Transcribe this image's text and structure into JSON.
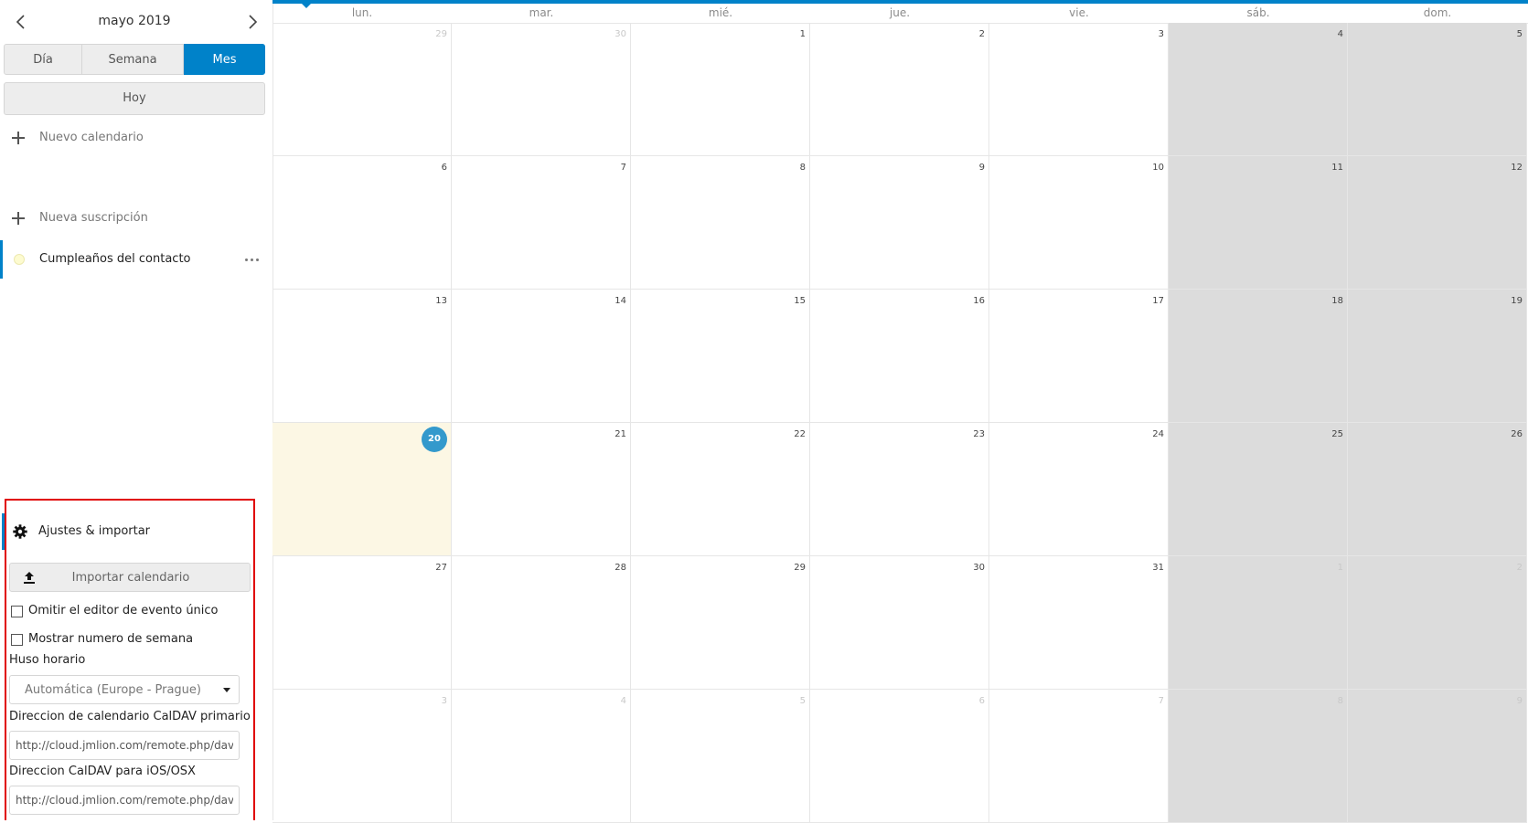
{
  "sidebar": {
    "month_label": "mayo 2019",
    "views": {
      "day": "Día",
      "week": "Semana",
      "month": "Mes",
      "active": "Mes"
    },
    "today": "Hoy",
    "new_calendar": "Nuevo calendario",
    "new_subscription": "Nueva suscripción",
    "calendars": [
      {
        "name": "Cumpleaños del contacto",
        "color": "#fdfbd0"
      }
    ],
    "settings": {
      "title": "Ajustes & importar",
      "import": "Importar calendario",
      "skip_popover": "Omitir el editor de evento único",
      "show_week_numbers": "Mostrar numero de semana",
      "timezone_label": "Huso horario",
      "timezone_value": "Automática (Europe - Prague)",
      "primary_caldav_label": "Direccion de calendario CalDAV primario",
      "primary_caldav_url": "http://cloud.jmlion.com/remote.php/dav/",
      "ios_caldav_label": "Direccion CalDAV para iOS/OSX",
      "ios_caldav_url": "http://cloud.jmlion.com/remote.php/dav/principals/"
    }
  },
  "calendar": {
    "weekdays": [
      "lun.",
      "mar.",
      "mié.",
      "jue.",
      "vie.",
      "sáb.",
      "dom."
    ],
    "weeks": [
      [
        "29",
        "30",
        "1",
        "2",
        "3",
        "4",
        "5"
      ],
      [
        "6",
        "7",
        "8",
        "9",
        "10",
        "11",
        "12"
      ],
      [
        "13",
        "14",
        "15",
        "16",
        "17",
        "18",
        "19"
      ],
      [
        "20",
        "21",
        "22",
        "23",
        "24",
        "25",
        "26"
      ],
      [
        "27",
        "28",
        "29",
        "30",
        "31",
        "1",
        "2"
      ],
      [
        "3",
        "4",
        "5",
        "6",
        "7",
        "8",
        "9"
      ]
    ],
    "today": "20"
  },
  "colors": {
    "accent": "#0082c9",
    "today_bg": "#fcf7e4",
    "today_badge": "#3399cc",
    "weekend_bg": "#dcdcdc",
    "highlight_border": "#e00000"
  }
}
